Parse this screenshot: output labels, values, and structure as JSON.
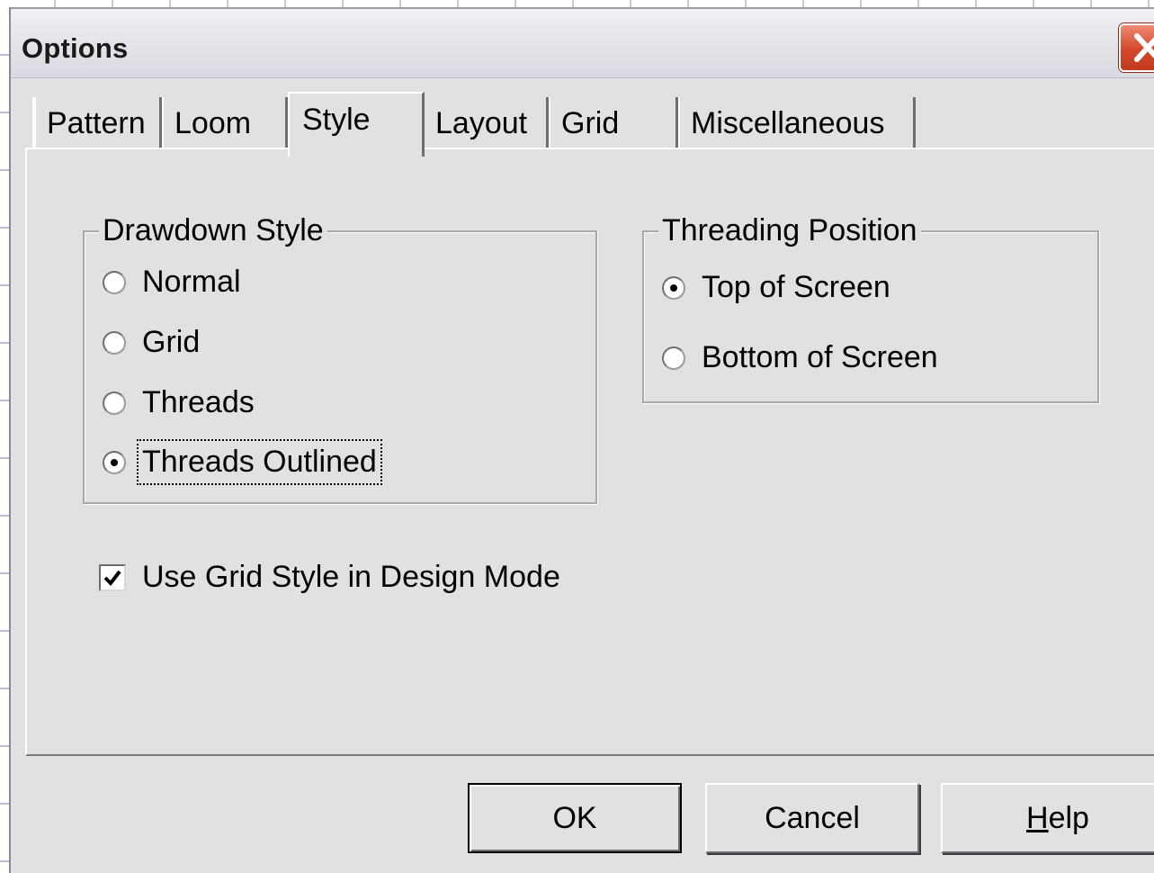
{
  "window": {
    "title": "Options",
    "close_icon": "close-icon"
  },
  "tabs": [
    {
      "label": "Pattern",
      "active": false
    },
    {
      "label": "Loom",
      "active": false
    },
    {
      "label": "Style",
      "active": true
    },
    {
      "label": "Layout",
      "active": false
    },
    {
      "label": "Grid",
      "active": false
    },
    {
      "label": "Miscellaneous",
      "active": false
    }
  ],
  "drawdown_style": {
    "label": "Drawdown Style",
    "options": [
      {
        "label": "Normal",
        "checked": false
      },
      {
        "label": "Grid",
        "checked": false
      },
      {
        "label": "Threads",
        "checked": false
      },
      {
        "label": "Threads Outlined",
        "checked": true
      }
    ]
  },
  "threading_position": {
    "label": "Threading Position",
    "options": [
      {
        "label": "Top of Screen",
        "checked": true
      },
      {
        "label": "Bottom of Screen",
        "checked": false
      }
    ]
  },
  "use_grid_style": {
    "label": "Use Grid Style in Design Mode",
    "checked": true
  },
  "buttons": {
    "ok": "OK",
    "cancel": "Cancel",
    "help_mnemonic": "H",
    "help_rest": "elp"
  },
  "colors": {
    "dialog_bg": "#e2e0e2",
    "close_button": "#d4472a"
  }
}
